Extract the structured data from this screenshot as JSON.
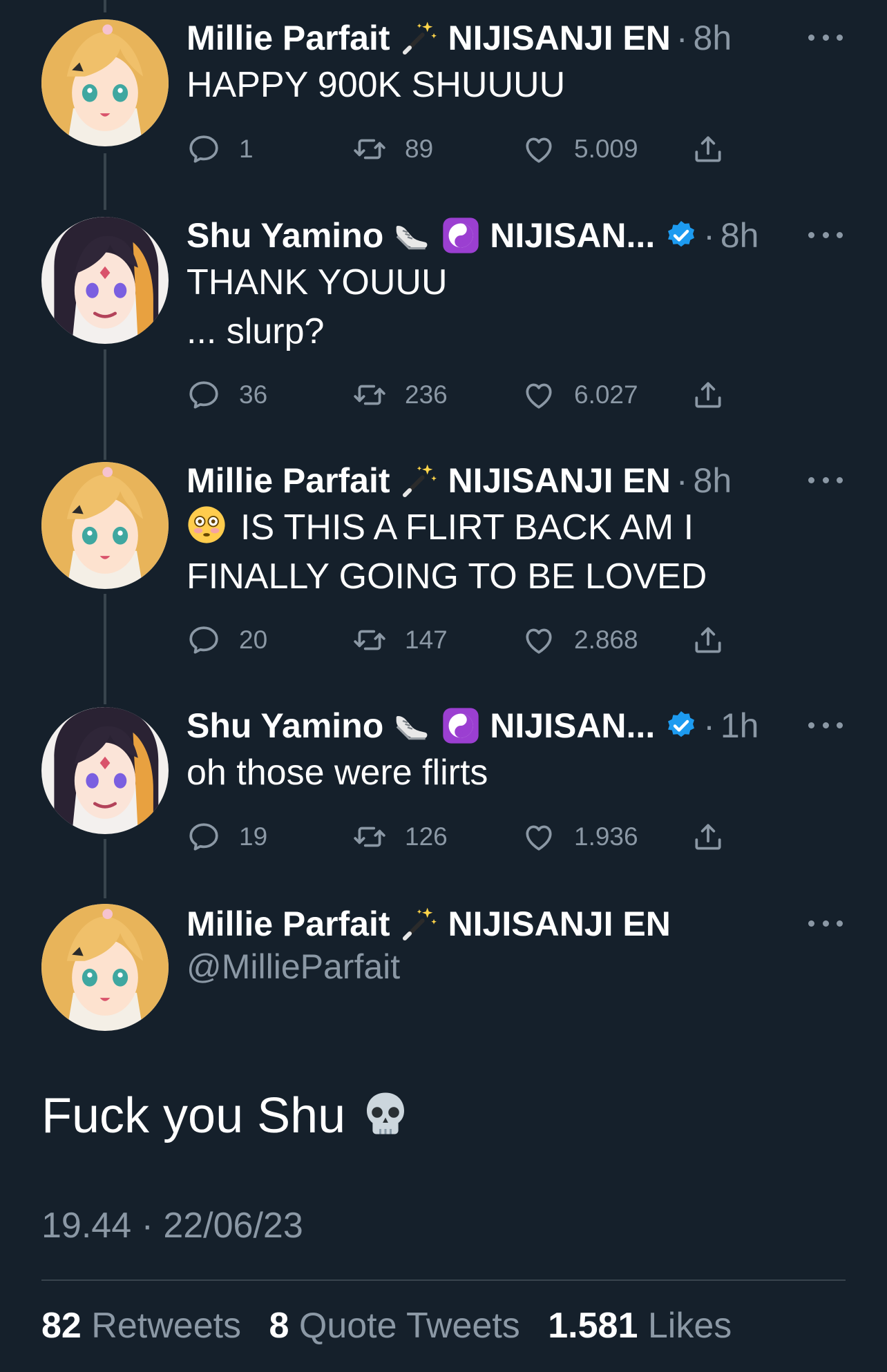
{
  "tweets": [
    {
      "name": "Millie Parfait",
      "org": "NIJISANJI EN",
      "time": "8h",
      "verified": false,
      "lines": [
        "HAPPY 900K SHUUUU"
      ],
      "replies": "1",
      "retweets": "89",
      "likes": "5.009"
    },
    {
      "name": "Shu Yamino",
      "org": "NIJISAN...",
      "time": "8h",
      "verified": true,
      "lines": [
        "THANK YOUUU",
        "... slurp?"
      ],
      "replies": "36",
      "retweets": "236",
      "likes": "6.027"
    },
    {
      "name": "Millie Parfait",
      "org": "NIJISANJI EN",
      "time": "8h",
      "verified": false,
      "lines": [
        "IS THIS A FLIRT BACK AM I",
        "FINALLY GOING TO BE LOVED"
      ],
      "replies": "20",
      "retweets": "147",
      "likes": "2.868"
    },
    {
      "name": "Shu Yamino",
      "org": "NIJISAN...",
      "time": "1h",
      "verified": true,
      "lines": [
        "oh those were flirts"
      ],
      "replies": "19",
      "retweets": "126",
      "likes": "1.936"
    }
  ],
  "main": {
    "name": "Millie Parfait",
    "org": "NIJISANJI EN",
    "handle": "@MillieParfait",
    "text": "Fuck you Shu",
    "timestamp": "19.44 · 22/06/23",
    "retweets_count": "82",
    "retweets_label": "Retweets",
    "quotes_count": "8",
    "quotes_label": "Quote Tweets",
    "likes_count": "1.581",
    "likes_label": "Likes"
  },
  "time_separator": "·",
  "icons": {
    "reply": "reply-icon",
    "retweet": "retweet-icon",
    "like": "heart-icon",
    "share": "share-icon",
    "verified": "verified-badge-icon",
    "more": "more-icon"
  },
  "colors": {
    "background": "#15202b",
    "muted": "#8b98a5",
    "verified": "#1d9bf0",
    "divider": "#38444d"
  }
}
